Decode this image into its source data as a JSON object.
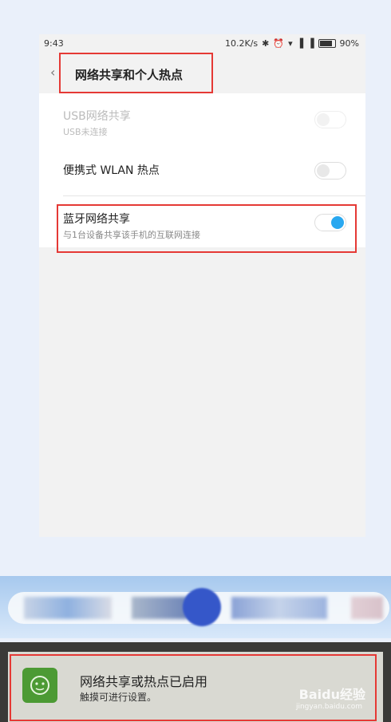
{
  "status_bar": {
    "time": "9:43",
    "speed": "10.2K/s",
    "battery": "90%",
    "icons": [
      "bluetooth-icon",
      "alarm-icon",
      "wifi-icon",
      "signal-icon",
      "signal-icon",
      "battery-icon"
    ]
  },
  "header": {
    "title": "网络共享和个人热点"
  },
  "settings": {
    "usb": {
      "title": "USB网络共享",
      "subtitle": "USB未连接",
      "enabled": false,
      "on": false
    },
    "wlan": {
      "title": "便携式 WLAN 热点",
      "on": false
    },
    "bluetooth": {
      "title": "蓝牙网络共享",
      "subtitle": "与1台设备共享该手机的互联网连接",
      "on": true
    }
  },
  "notification": {
    "title": "网络共享或热点已启用",
    "subtitle": "触摸可进行设置。"
  },
  "watermark": {
    "brand": "Baidu经验",
    "url": "jingyan.baidu.com"
  },
  "colors": {
    "highlight": "#e53935",
    "toggle_on": "#29a8f0"
  }
}
